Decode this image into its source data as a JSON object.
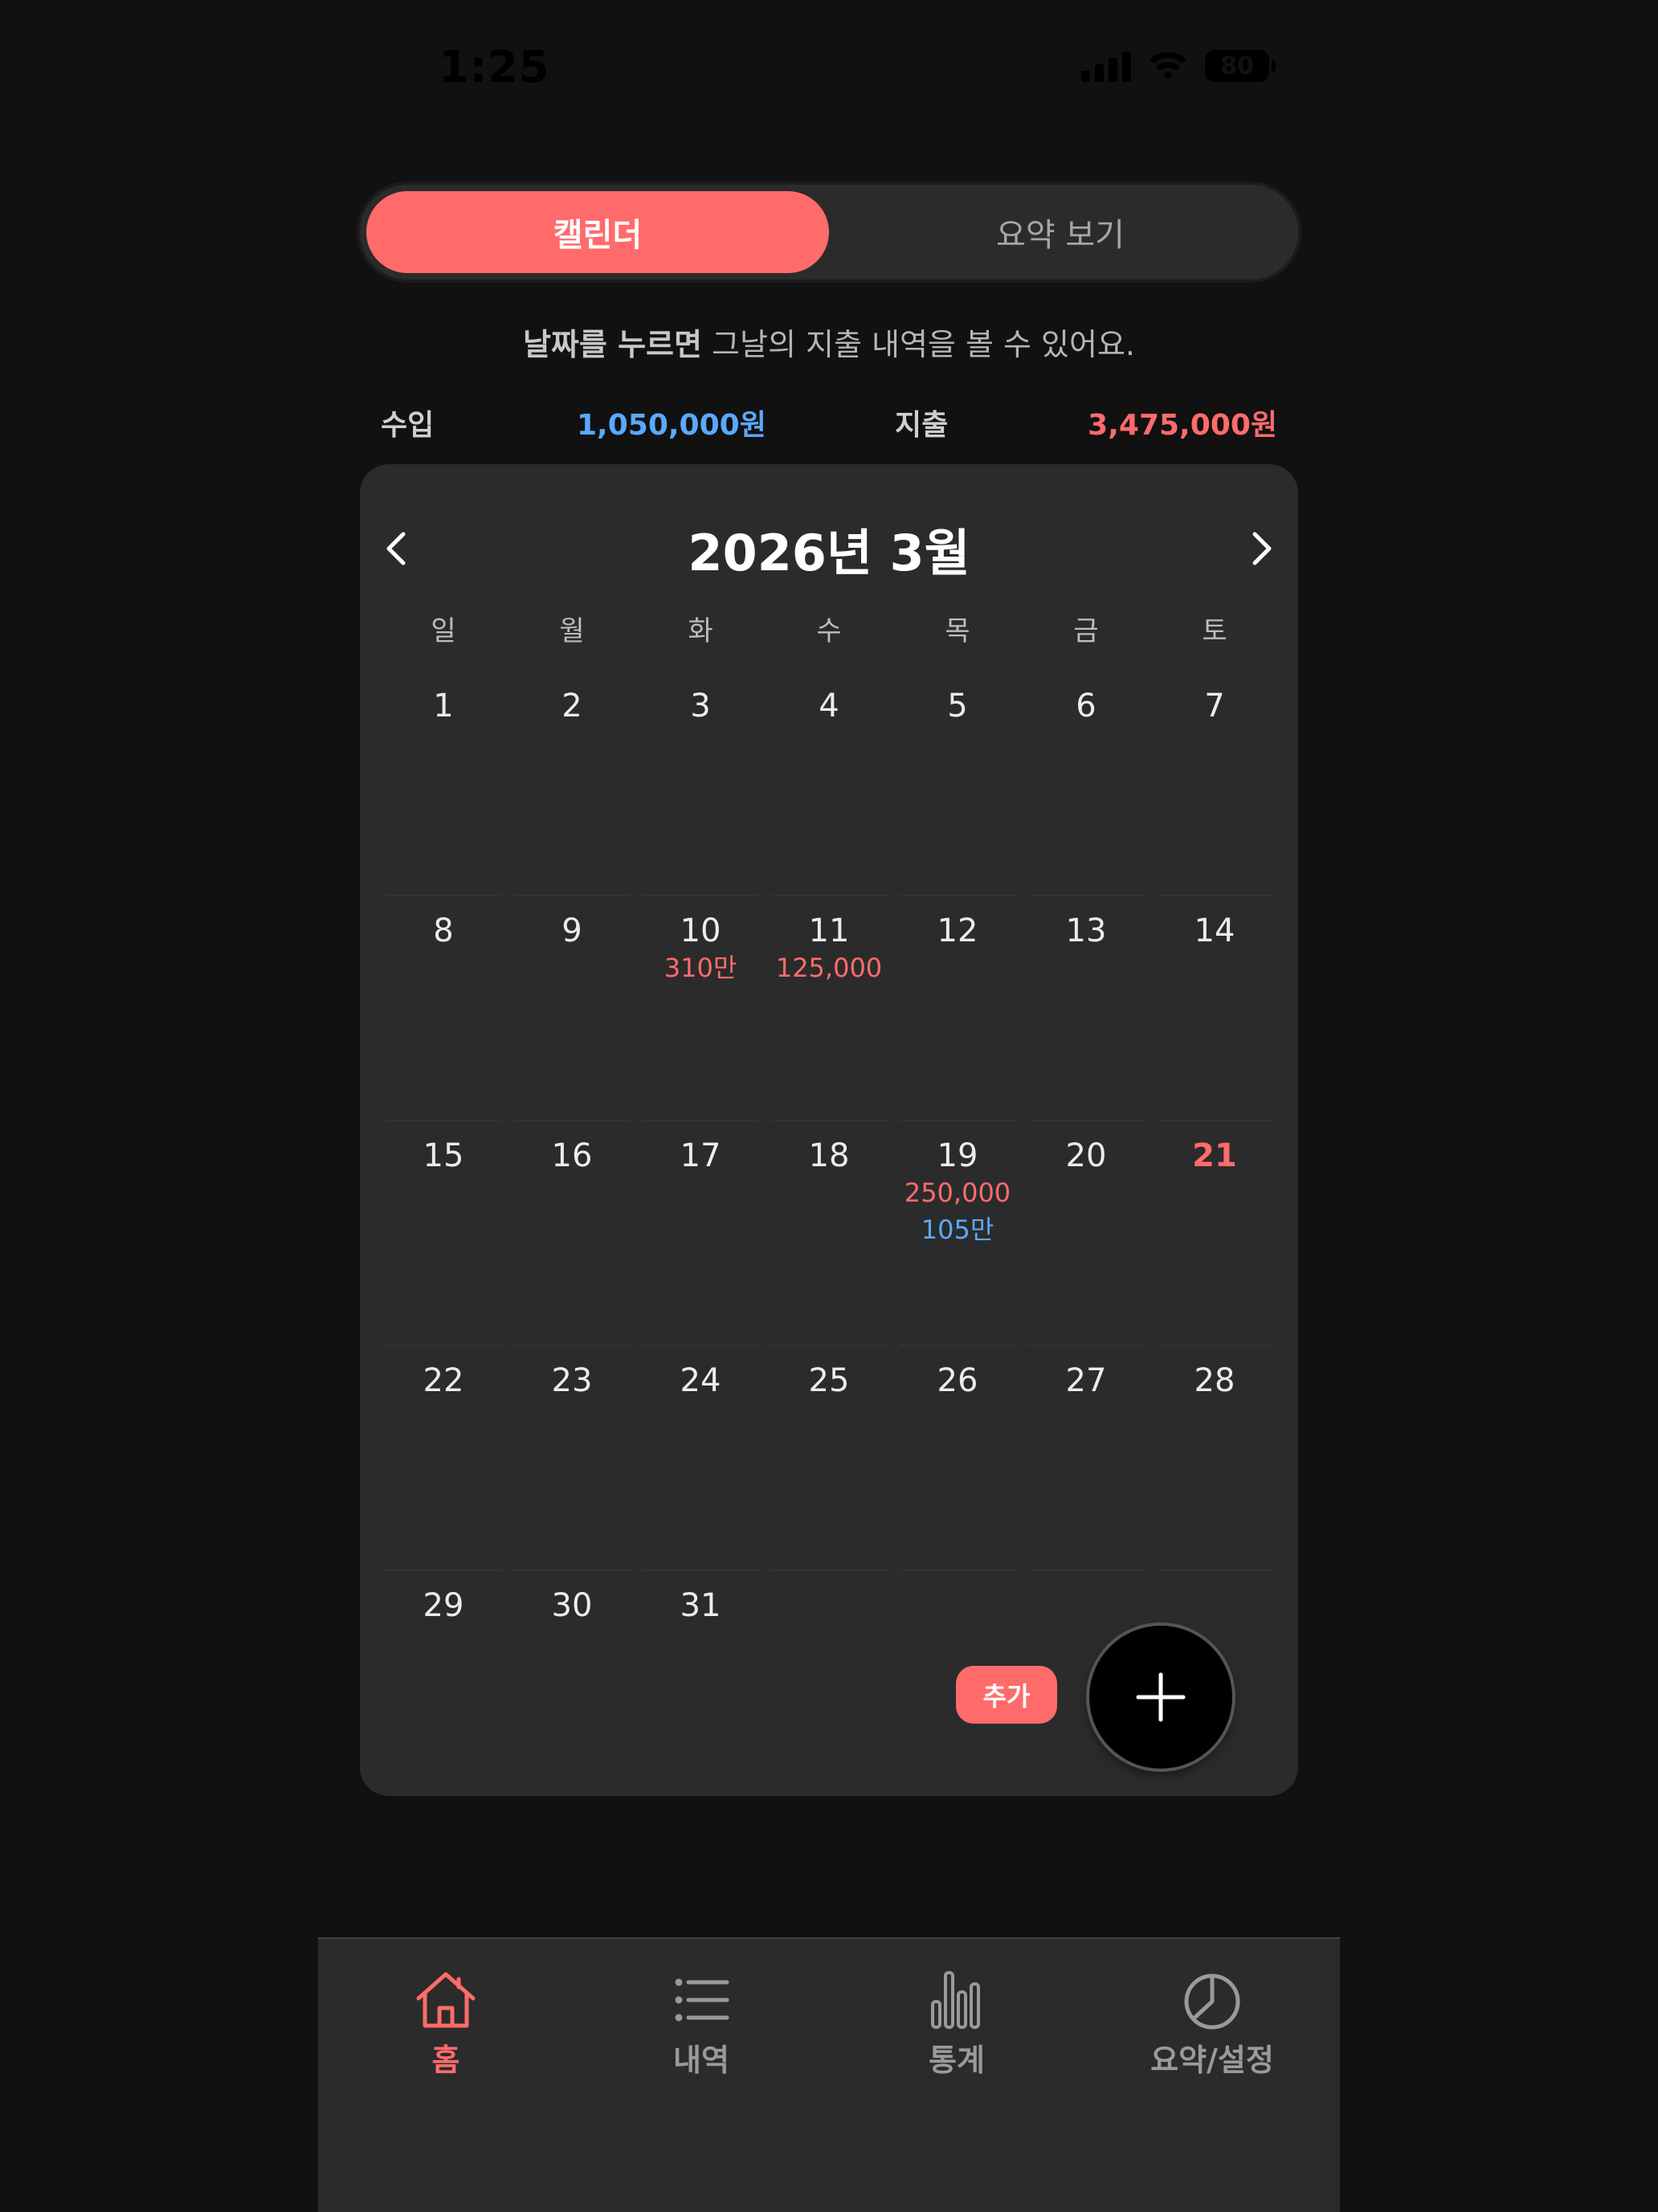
{
  "status_bar": {
    "time": "1:25",
    "battery": "80"
  },
  "segment": {
    "active_label": "캘린더",
    "inactive_label": "요약 보기"
  },
  "hint": {
    "bold": "날짜를 누르면",
    "rest": " 그날의 지출 내역을 볼 수 있어요."
  },
  "totals": {
    "income_label": "수입",
    "income_value": "1,050,000원",
    "expense_label": "지출",
    "expense_value": "3,475,000원"
  },
  "calendar": {
    "title": "2026년 3월",
    "weekdays": [
      "일",
      "월",
      "화",
      "수",
      "목",
      "금",
      "토"
    ],
    "days": [
      {
        "num": "1"
      },
      {
        "num": "2"
      },
      {
        "num": "3"
      },
      {
        "num": "4"
      },
      {
        "num": "5"
      },
      {
        "num": "6"
      },
      {
        "num": "7"
      },
      {
        "num": "8"
      },
      {
        "num": "9"
      },
      {
        "num": "10",
        "exp": "310만"
      },
      {
        "num": "11",
        "exp": "125,000"
      },
      {
        "num": "12"
      },
      {
        "num": "13"
      },
      {
        "num": "14"
      },
      {
        "num": "15"
      },
      {
        "num": "16"
      },
      {
        "num": "17"
      },
      {
        "num": "18"
      },
      {
        "num": "19",
        "exp": "250,000",
        "inc": "105만"
      },
      {
        "num": "20"
      },
      {
        "num": "21",
        "today": true
      },
      {
        "num": "22"
      },
      {
        "num": "23"
      },
      {
        "num": "24"
      },
      {
        "num": "25"
      },
      {
        "num": "26"
      },
      {
        "num": "27"
      },
      {
        "num": "28"
      },
      {
        "num": "29"
      },
      {
        "num": "30"
      },
      {
        "num": "31"
      }
    ]
  },
  "add_chip": "추가",
  "nav": [
    {
      "label": "홈",
      "icon": "home-icon",
      "active": true
    },
    {
      "label": "내역",
      "icon": "list-icon",
      "active": false
    },
    {
      "label": "통계",
      "icon": "bar-chart-icon",
      "active": false
    },
    {
      "label": "요약/설정",
      "icon": "pie-chart-icon",
      "active": false
    }
  ],
  "colors": {
    "accent": "#ff6b6b",
    "income": "#5aa9ff",
    "card": "#2b2b2b",
    "background": "#111111"
  }
}
